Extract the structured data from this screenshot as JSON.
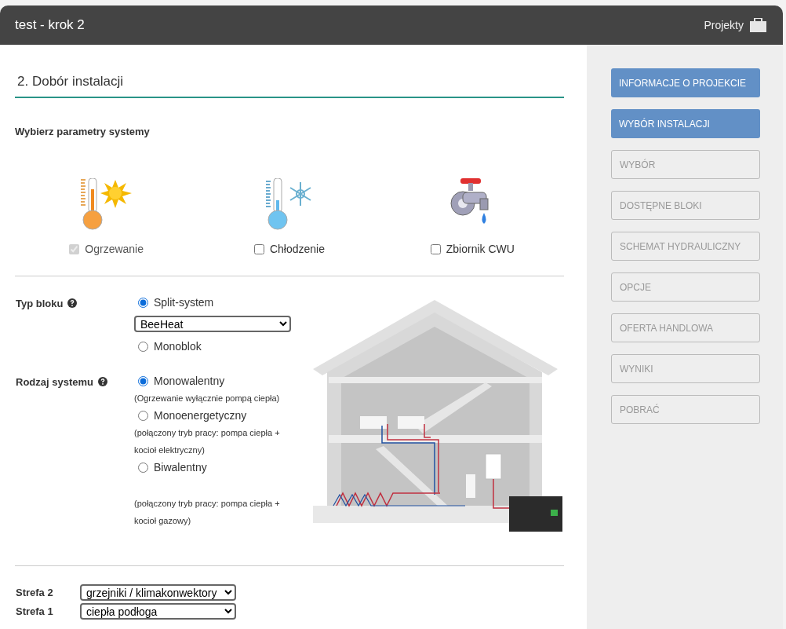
{
  "header": {
    "title": "test - krok 2",
    "projects_link": "Projekty"
  },
  "section_title": "2. Dobór instalacji",
  "subtitle": "Wybierz parametry systemy",
  "systems": [
    {
      "kind": "heating",
      "label": "Ogrzewanie",
      "checked": true,
      "disabled": true
    },
    {
      "kind": "cooling",
      "label": "Chłodzenie",
      "checked": false,
      "disabled": false
    },
    {
      "kind": "tap",
      "label": "Zbiornik CWU",
      "checked": false,
      "disabled": false
    }
  ],
  "unit_type": {
    "label": "Typ bloku",
    "options": [
      {
        "label": "Split-system",
        "selected": true,
        "dropdown": "BeeHeat"
      },
      {
        "label": "Monoblok",
        "selected": false
      }
    ]
  },
  "system_kind": {
    "label": "Rodzaj systemu",
    "options": [
      {
        "label": "Monowalentny",
        "selected": true,
        "notes": [
          "(Ogrzewanie wyłącznie pompą ciepła)"
        ]
      },
      {
        "label": "Monoenergetyczny",
        "selected": false,
        "notes": [
          "(połączony tryb pracy: pompa ciepła +",
          "kocioł elektryczny)"
        ]
      },
      {
        "label": "Biwalentny",
        "selected": false,
        "notes": [
          "(połączony tryb pracy: pompa ciepła +",
          "kocioł gazowy)"
        ]
      }
    ]
  },
  "zones": [
    {
      "label": "Strefa 2",
      "value": "grzejniki / klimakonwektory"
    },
    {
      "label": "Strefa 1",
      "value": "ciepła podłoga"
    }
  ],
  "steps": [
    {
      "label": "INFORMACJE O PROJEKCIE",
      "enabled": true
    },
    {
      "label": "WYBÓR INSTALACJI",
      "enabled": true
    },
    {
      "label": "WYBÓR",
      "enabled": false
    },
    {
      "label": "DOSTĘPNE BLOKI",
      "enabled": false
    },
    {
      "label": "SCHEMAT HYDRAULICZNY",
      "enabled": false
    },
    {
      "label": "OPCJE",
      "enabled": false
    },
    {
      "label": "OFERTA HANDLOWA",
      "enabled": false
    },
    {
      "label": "WYNIKI",
      "enabled": false
    },
    {
      "label": "POBRAĆ",
      "enabled": false
    }
  ]
}
